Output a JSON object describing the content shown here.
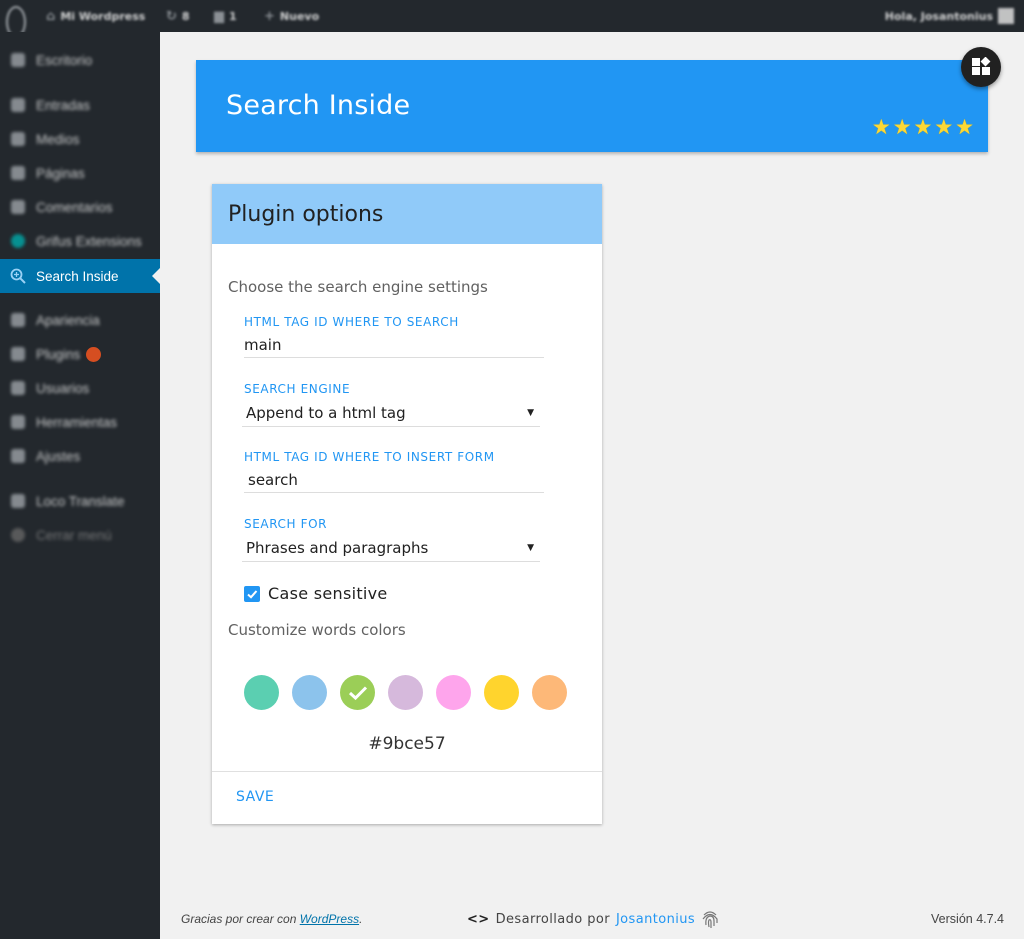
{
  "admin_bar": {
    "site_name": "Mi Wordpress",
    "updates_count": "8",
    "comments_count": "1",
    "new_label": "Nuevo",
    "greeting": "Hola, Josantonius"
  },
  "sidebar": {
    "items": [
      {
        "label": "Escritorio",
        "icon": "dashboard-icon"
      },
      {
        "label": "Entradas",
        "icon": "pin-icon"
      },
      {
        "label": "Medios",
        "icon": "media-icon"
      },
      {
        "label": "Páginas",
        "icon": "page-icon"
      },
      {
        "label": "Comentarios",
        "icon": "comment-icon"
      },
      {
        "label": "Grifus Extensions",
        "icon": "globe-icon"
      },
      {
        "label": "Search Inside",
        "icon": "search-icon"
      },
      {
        "label": "Apariencia",
        "icon": "brush-icon"
      },
      {
        "label": "Plugins",
        "icon": "plugin-icon"
      },
      {
        "label": "Usuarios",
        "icon": "user-icon"
      },
      {
        "label": "Herramientas",
        "icon": "wrench-icon"
      },
      {
        "label": "Ajustes",
        "icon": "settings-icon"
      },
      {
        "label": "Loco Translate",
        "icon": "translate-icon"
      },
      {
        "label": "Cerrar menú",
        "icon": "collapse-icon"
      }
    ]
  },
  "header": {
    "title": "Search Inside",
    "rating": 5,
    "star_color": "#fdd835",
    "background": "#2196f3"
  },
  "card": {
    "title": "Plugin options",
    "engine_section": "Choose the search engine settings",
    "fields": {
      "tag_id_search": {
        "label": "HTML TAG ID WHERE TO SEARCH",
        "value": "main"
      },
      "search_engine": {
        "label": "SEARCH ENGINE",
        "value": "Append to a html tag"
      },
      "tag_id_form": {
        "label": "HTML TAG ID WHERE TO INSERT FORM",
        "value": "search"
      },
      "search_for": {
        "label": "SEARCH FOR",
        "value": "Phrases and paragraphs"
      }
    },
    "case_sensitive": {
      "label": "Case sensitive",
      "checked": true
    },
    "colors_section": "Customize words colors",
    "colors": [
      "#5bcfb1",
      "#8cc3ec",
      "#9bce57",
      "#d6b9dc",
      "#fea5ec",
      "#ffd42d",
      "#fdb878"
    ],
    "selected_color": "#9bce57",
    "save_label": "SAVE"
  },
  "footer": {
    "thanks_text": "Gracias por crear con ",
    "wordpress_link": "WordPress",
    "thanks_end": ".",
    "developed_by": "Desarrollado por",
    "author": "Josantonius",
    "version": "Versión 4.7.4"
  }
}
